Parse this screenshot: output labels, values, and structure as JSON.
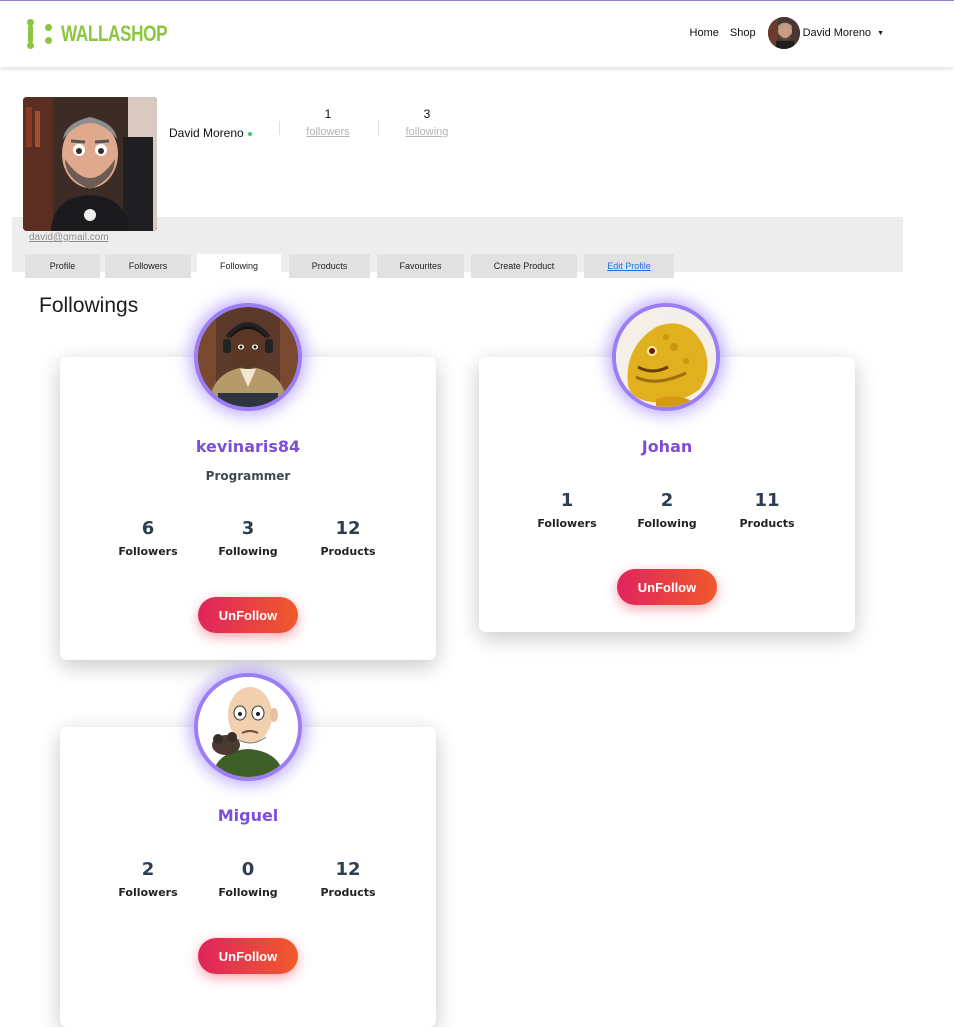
{
  "brand": {
    "name": "WALLASHOP",
    "color": "#8cc63f"
  },
  "nav": {
    "home": "Home",
    "shop": "Shop",
    "user_name": "David Moreno",
    "caret_icon": "caret-down-icon"
  },
  "profile": {
    "name": "David Moreno",
    "online": true,
    "followers_count": "1",
    "followers_label": "followers",
    "following_count": "3",
    "following_label": "following",
    "email": "david@gmail.com"
  },
  "tabs": [
    {
      "label": "Profile"
    },
    {
      "label": "Followers"
    },
    {
      "label": "Following",
      "active": true
    },
    {
      "label": "Products"
    },
    {
      "label": "Favourites"
    },
    {
      "label": "Create Product"
    },
    {
      "label": "Edit Profile",
      "link": true
    }
  ],
  "section_title": "Followings",
  "followings": [
    {
      "name": "kevinaris84",
      "role": "Programmer",
      "followers": "6",
      "following": "3",
      "products": "12",
      "button": "UnFollow"
    },
    {
      "name": "Johan",
      "role": "",
      "followers": "1",
      "following": "2",
      "products": "11",
      "button": "UnFollow"
    },
    {
      "name": "Miguel",
      "role": "",
      "followers": "2",
      "following": "0",
      "products": "12",
      "button": "UnFollow"
    }
  ],
  "stat_labels": {
    "followers": "Followers",
    "following": "Following",
    "products": "Products"
  },
  "colors": {
    "accent": "#7c4fd9",
    "avatar_ring": "#9b7df5",
    "button_from": "#e0245e",
    "button_to": "#f05a2b",
    "online": "#2ecc71",
    "link": "#1f6ed4"
  }
}
